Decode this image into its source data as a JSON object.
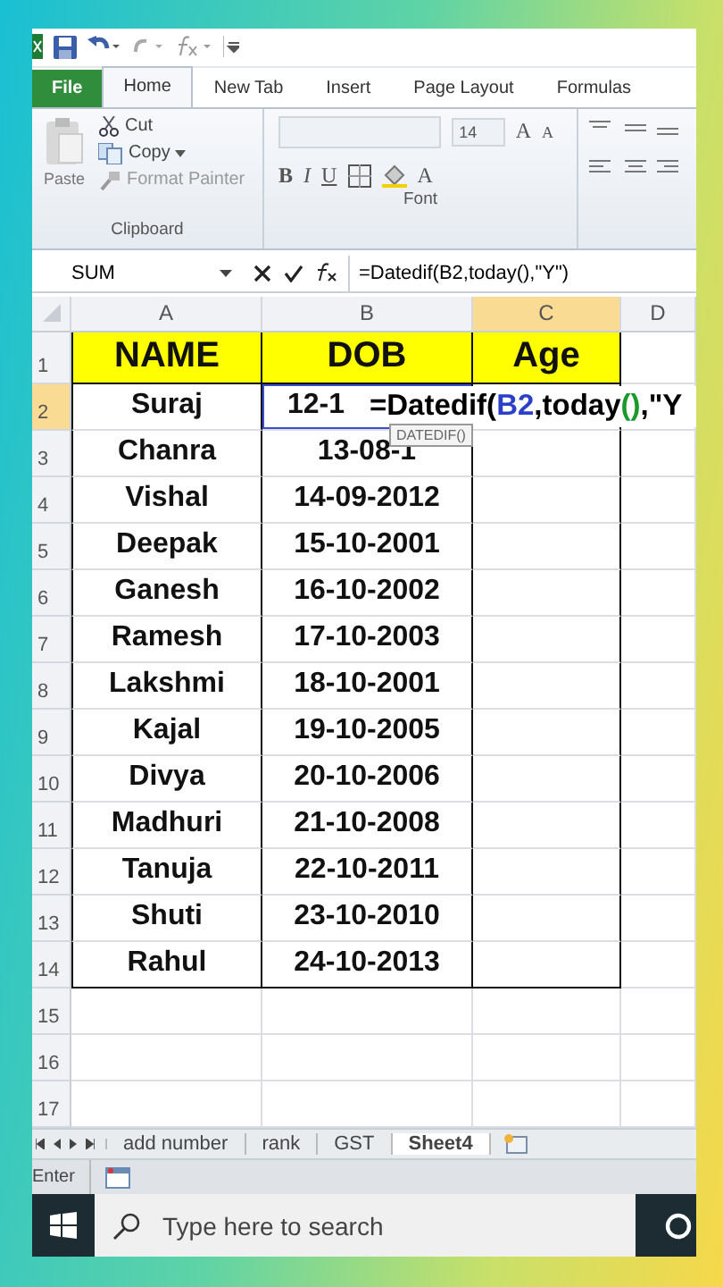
{
  "ribbon_tabs": [
    {
      "label": "File",
      "kind": "file",
      "selected": false
    },
    {
      "label": "Home",
      "kind": "tab",
      "selected": true
    },
    {
      "label": "New Tab",
      "kind": "tab",
      "selected": false
    },
    {
      "label": "Insert",
      "kind": "tab",
      "selected": false
    },
    {
      "label": "Page Layout",
      "kind": "tab",
      "selected": false
    },
    {
      "label": "Formulas",
      "kind": "tab",
      "selected": false
    }
  ],
  "clipboard": {
    "paste": "Paste",
    "cut": "Cut",
    "copy": "Copy",
    "format_painter": "Format Painter",
    "group_label": "Clipboard"
  },
  "font": {
    "size": "14",
    "bold": "B",
    "italic": "I",
    "underline": "U",
    "font_color": "A",
    "grow": "A",
    "shrink": "A",
    "group_label": "Font"
  },
  "formula_bar": {
    "name_box": "SUM",
    "formula": "=Datedif(B2,today(),\"Y\")"
  },
  "columns": [
    {
      "label": "A",
      "selected": false
    },
    {
      "label": "B",
      "selected": false
    },
    {
      "label": "C",
      "selected": true
    },
    {
      "label": "D",
      "selected": false
    }
  ],
  "header_row": {
    "number": "1",
    "selected": false,
    "cells": [
      "NAME",
      "DOB",
      "Age"
    ]
  },
  "rows": [
    {
      "number": "2",
      "selected": true,
      "name": "Suraj",
      "dob": "12-1"
    },
    {
      "number": "3",
      "selected": false,
      "name": "Chanra",
      "dob": "13-08-1"
    },
    {
      "number": "4",
      "selected": false,
      "name": "Vishal",
      "dob": "14-09-2012"
    },
    {
      "number": "5",
      "selected": false,
      "name": "Deepak",
      "dob": "15-10-2001"
    },
    {
      "number": "6",
      "selected": false,
      "name": "Ganesh",
      "dob": "16-10-2002"
    },
    {
      "number": "7",
      "selected": false,
      "name": "Ramesh",
      "dob": "17-10-2003"
    },
    {
      "number": "8",
      "selected": false,
      "name": "Lakshmi",
      "dob": "18-10-2001"
    },
    {
      "number": "9",
      "selected": false,
      "name": "Kajal",
      "dob": "19-10-2005"
    },
    {
      "number": "10",
      "selected": false,
      "name": "Divya",
      "dob": "20-10-2006"
    },
    {
      "number": "11",
      "selected": false,
      "name": "Madhuri",
      "dob": "21-10-2008"
    },
    {
      "number": "12",
      "selected": false,
      "name": "Tanuja",
      "dob": "22-10-2011"
    },
    {
      "number": "13",
      "selected": false,
      "name": "Shuti",
      "dob": "23-10-2010"
    },
    {
      "number": "14",
      "selected": false,
      "name": "Rahul",
      "dob": "24-10-2013"
    }
  ],
  "empty_rows": [
    "15",
    "16",
    "17"
  ],
  "cell_edit": {
    "parts": [
      {
        "text": "=Datedif(",
        "color": "#000000"
      },
      {
        "text": "B2",
        "color": "#2b3fc7"
      },
      {
        "text": ",today",
        "color": "#000000"
      },
      {
        "text": "()",
        "color": "#1a9a2a"
      },
      {
        "text": ",\"Y",
        "color": "#000000"
      }
    ],
    "tooltip": "DATEDIF()"
  },
  "sheet_tabs": [
    {
      "label": "add number",
      "selected": false
    },
    {
      "label": "rank",
      "selected": false
    },
    {
      "label": "GST",
      "selected": false
    },
    {
      "label": "Sheet4",
      "selected": true
    }
  ],
  "status_bar": {
    "mode": "Enter"
  },
  "taskbar": {
    "search_placeholder": "Type here to search"
  }
}
